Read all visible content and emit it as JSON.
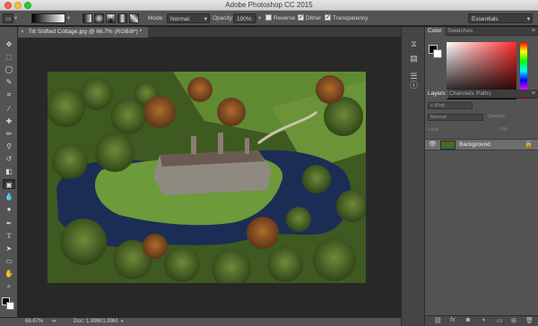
{
  "window": {
    "title": "Adobe Photoshop CC 2015"
  },
  "options_bar": {
    "mode_label": "Mode:",
    "mode_value": "Normal",
    "opacity_label": "Opacity:",
    "opacity_value": "100%",
    "reverse_label": "Reverse",
    "reverse_checked": false,
    "dither_label": "Dither",
    "dither_checked": true,
    "transparency_label": "Transparency",
    "transparency_checked": true,
    "workspace_value": "Essentials"
  },
  "document": {
    "tab_title": "Tilt Shifted Cottage.jpg @ 66.7% (RGB/8*) *"
  },
  "status": {
    "zoom": "66.67%",
    "doc_size": "Doc: 1.99M/1.99M"
  },
  "color_panel": {
    "tabs": [
      "Color",
      "Swatches"
    ],
    "foreground": "#000000",
    "background": "#ffffff"
  },
  "layers_panel": {
    "tabs": [
      "Layers",
      "Channels",
      "Paths"
    ],
    "kind_placeholder": "Kind",
    "blend_mode": "Normal",
    "opacity_label": "Opacity:",
    "lock_label": "Lock:",
    "fill_label": "Fill:",
    "layers": [
      {
        "name": "Background",
        "visible": true,
        "locked": true
      }
    ]
  },
  "tools": [
    "move-tool",
    "marquee-tool",
    "lasso-tool",
    "quick-select-tool",
    "crop-tool",
    "eyedropper-tool",
    "healing-brush-tool",
    "brush-tool",
    "clone-stamp-tool",
    "history-brush-tool",
    "eraser-tool",
    "gradient-tool",
    "blur-tool",
    "dodge-tool",
    "pen-tool",
    "type-tool",
    "path-select-tool",
    "rectangle-tool",
    "hand-tool",
    "zoom-tool"
  ],
  "icons": {
    "dock": [
      "history-icon",
      "adjustments-icon",
      "properties-icon",
      "info-icon"
    ],
    "layers_footer": [
      "link-icon",
      "fx-icon",
      "mask-icon",
      "adjustment-layer-icon",
      "group-icon",
      "new-layer-icon",
      "trash-icon"
    ]
  }
}
